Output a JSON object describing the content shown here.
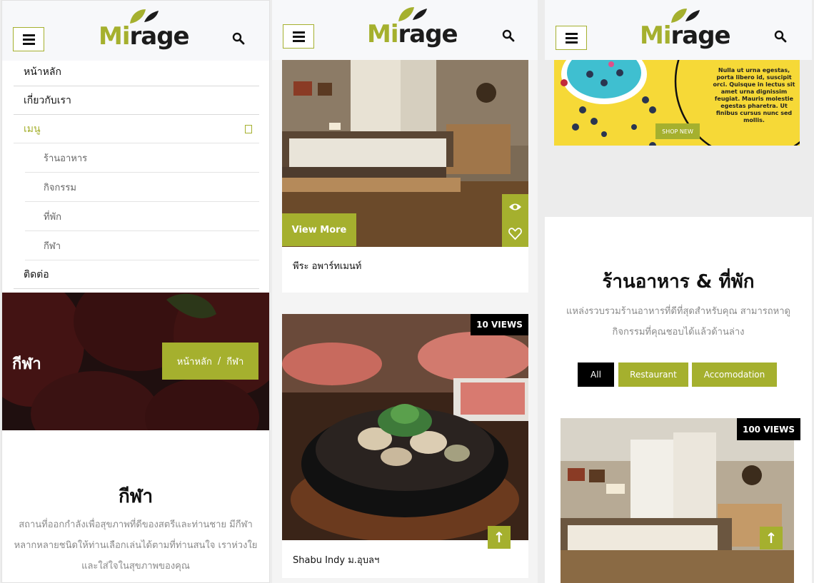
{
  "brand": {
    "logo_mi": "Mi",
    "logo_rage": "rage",
    "accent_color": "#a5b02e"
  },
  "panel1": {
    "menu": {
      "items": [
        {
          "label": "หน้าหลัก"
        },
        {
          "label": "เกี่ยวกับเรา"
        },
        {
          "label": "เมนู"
        },
        {
          "label": "ติดต่อ"
        }
      ],
      "submenu": [
        {
          "label": "ร้านอาหาร"
        },
        {
          "label": "กิจกรรม"
        },
        {
          "label": "ที่พัก"
        },
        {
          "label": "กีฬา"
        }
      ]
    },
    "hero": {
      "title": "กีฬา",
      "breadcrumb_home": "หน้าหลัก",
      "breadcrumb_sep": "/",
      "breadcrumb_current": "กีฬา"
    },
    "section": {
      "title": "กีฬา",
      "description": "สถานที่ออกกำลังเพื่อสุขภาพที่ดีของสตรีและท่านชาย มีกีฬาหลากหลายชนิดให้ท่านเลือกเล่นได้ตามที่ท่านสนใจ เราห่วงใย และใส่ใจในสุขภาพของคุณ"
    }
  },
  "panel2": {
    "card1": {
      "caption": "พีระ อพาร์ทเมนท์",
      "view_more": "View More"
    },
    "card2": {
      "caption": "Shabu Indy ม.อุบลฯ",
      "views": "10 VIEWS",
      "up": "↑"
    }
  },
  "panel3": {
    "promo": {
      "text": "Nulla ut urna egestas, porta libero id, suscipit orci. Quisque in lectus sit amet urna dignissim feugiat. Mauris molestie egestas pharetra. Ut finibus cursus nunc sed mollis.",
      "button": "SHOP NEW"
    },
    "section": {
      "title": "ร้านอาหาร & ที่พัก",
      "description": "แหล่งรวบรวมร้านอาหารที่ดีที่สุดสำหรับคุณ สามารถหาดูกิจกรรมที่คุณชอบได้แล้วด้านล่าง"
    },
    "filters": [
      {
        "label": "All"
      },
      {
        "label": "Restaurant"
      },
      {
        "label": "Accomodation"
      }
    ],
    "card": {
      "views": "100 VIEWS",
      "up": "↑"
    }
  }
}
